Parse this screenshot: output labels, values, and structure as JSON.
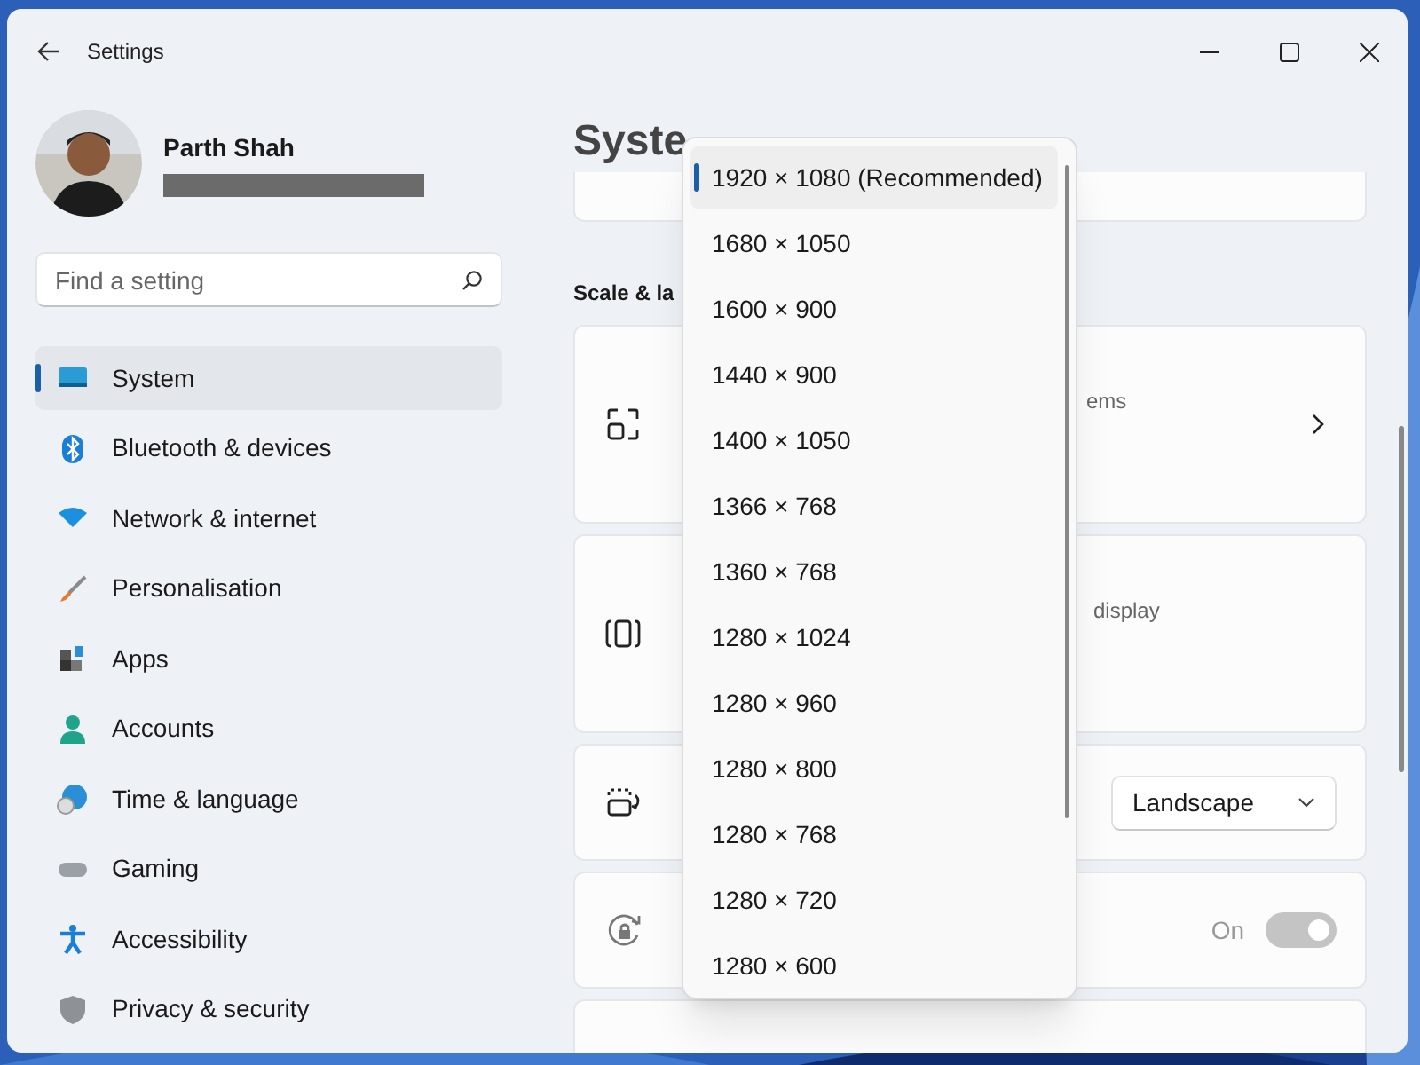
{
  "window": {
    "title": "Settings"
  },
  "account": {
    "name": "Parth Shah"
  },
  "search": {
    "placeholder": "Find a setting"
  },
  "sidebar": {
    "items": [
      {
        "label": "System",
        "selected": true
      },
      {
        "label": "Bluetooth & devices",
        "selected": false
      },
      {
        "label": "Network & internet",
        "selected": false
      },
      {
        "label": "Personalisation",
        "selected": false
      },
      {
        "label": "Apps",
        "selected": false
      },
      {
        "label": "Accounts",
        "selected": false
      },
      {
        "label": "Time & language",
        "selected": false
      },
      {
        "label": "Gaming",
        "selected": false
      },
      {
        "label": "Accessibility",
        "selected": false
      },
      {
        "label": "Privacy & security",
        "selected": false
      }
    ]
  },
  "header": {
    "breadcrumb": "Syste"
  },
  "section_title": "Scale & la",
  "cards": [
    {
      "kind": "link",
      "fragment": "ems"
    },
    {
      "kind": "plain",
      "fragment": "display"
    },
    {
      "kind": "dropdown",
      "value": "Landscape"
    },
    {
      "kind": "toggle",
      "state_label": "On",
      "on": true,
      "disabled": true
    },
    {
      "kind": "empty"
    }
  ],
  "resolution_menu": {
    "options": [
      {
        "label": "1920 × 1080 (Recommended)",
        "selected": true
      },
      {
        "label": "1680 × 1050",
        "selected": false
      },
      {
        "label": "1600 × 900",
        "selected": false
      },
      {
        "label": "1440 × 900",
        "selected": false
      },
      {
        "label": "1400 × 1050",
        "selected": false
      },
      {
        "label": "1366 × 768",
        "selected": false
      },
      {
        "label": "1360 × 768",
        "selected": false
      },
      {
        "label": "1280 × 1024",
        "selected": false
      },
      {
        "label": "1280 × 960",
        "selected": false
      },
      {
        "label": "1280 × 800",
        "selected": false
      },
      {
        "label": "1280 × 768",
        "selected": false
      },
      {
        "label": "1280 × 720",
        "selected": false
      },
      {
        "label": "1280 × 600",
        "selected": false
      }
    ]
  }
}
